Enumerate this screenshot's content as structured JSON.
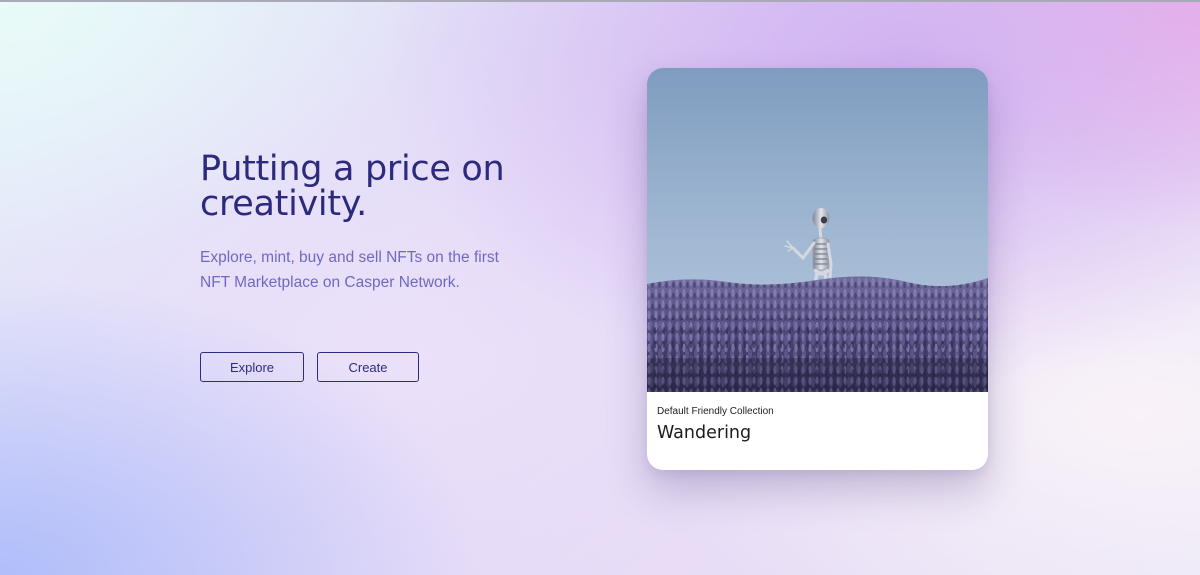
{
  "hero": {
    "headline_line1": "Putting a price on",
    "headline_line2": "creativity.",
    "subtext": "Explore, mint, buy and sell NFTs on the first NFT Marketplace on Casper Network."
  },
  "actions": {
    "explore_label": "Explore",
    "create_label": "Create"
  },
  "featured_nft": {
    "collection": "Default Friendly Collection",
    "title": "Wandering"
  },
  "colors": {
    "headline": "#2c2a7d",
    "subtext": "#6f69c2",
    "button_border": "#2e2b80",
    "card_bg": "#ffffff"
  }
}
